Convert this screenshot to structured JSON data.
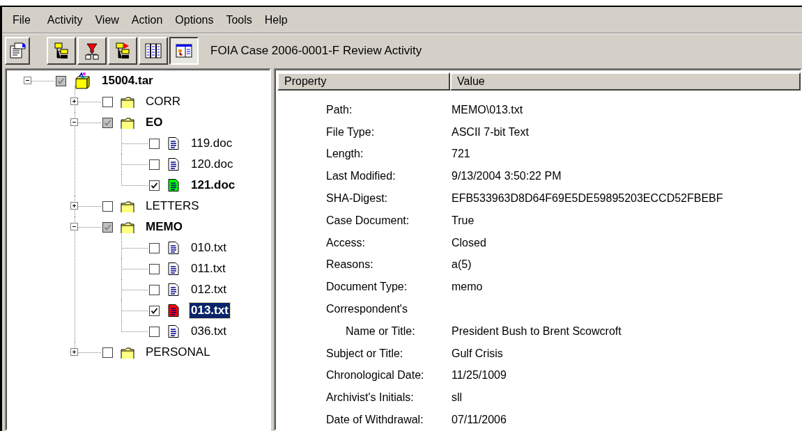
{
  "menu_bar": [
    "File",
    "Activity",
    "View",
    "Action",
    "Options",
    "Tools",
    "Help"
  ],
  "toolbar": {
    "button_groups": [
      [
        {
          "kind": "properties",
          "pressed": false
        }
      ],
      [
        {
          "kind": "tree-yellow",
          "pressed": false
        },
        {
          "kind": "tree-red",
          "pressed": false
        },
        {
          "kind": "tree-flag",
          "pressed": false
        },
        {
          "kind": "columns",
          "pressed": false
        },
        {
          "kind": "details",
          "pressed": true
        }
      ]
    ],
    "title": "FOIA Case 2006-0001-F Review Activity"
  },
  "tree": [
    {
      "name": "15004.tar",
      "kind": "archive",
      "checked": true,
      "partial": true,
      "bold": true,
      "selected": false,
      "expanded": true,
      "children": [
        {
          "name": "CORR",
          "kind": "folder",
          "checked": false,
          "partial": false,
          "bold": false,
          "selected": false,
          "expanded": false
        },
        {
          "name": "EO",
          "kind": "folder",
          "checked": true,
          "partial": true,
          "bold": true,
          "selected": false,
          "expanded": true,
          "children": [
            {
              "name": "119.doc",
              "kind": "document",
              "checked": false,
              "partial": false,
              "bold": false,
              "selected": false
            },
            {
              "name": "120.doc",
              "kind": "document",
              "checked": false,
              "partial": false,
              "bold": false,
              "selected": false
            },
            {
              "name": "121.doc",
              "kind": "document",
              "color": "#00ff00",
              "checked": true,
              "partial": false,
              "bold": true,
              "selected": false
            }
          ]
        },
        {
          "name": "LETTERS",
          "kind": "folder",
          "checked": false,
          "partial": false,
          "bold": false,
          "selected": false,
          "expanded": false
        },
        {
          "name": "MEMO",
          "kind": "folder",
          "checked": true,
          "partial": true,
          "bold": true,
          "selected": false,
          "expanded": true,
          "children": [
            {
              "name": "010.txt",
              "kind": "document",
              "checked": false,
              "partial": false,
              "bold": false,
              "selected": false
            },
            {
              "name": "011.txt",
              "kind": "document",
              "checked": false,
              "partial": false,
              "bold": false,
              "selected": false
            },
            {
              "name": "012.txt",
              "kind": "document",
              "checked": false,
              "partial": false,
              "bold": false,
              "selected": false
            },
            {
              "name": "013.txt",
              "kind": "document",
              "color": "#ff0000",
              "checked": true,
              "partial": false,
              "bold": true,
              "selected": true
            },
            {
              "name": "036.txt",
              "kind": "document",
              "checked": false,
              "partial": false,
              "bold": false,
              "selected": false
            }
          ]
        },
        {
          "name": "PERSONAL",
          "kind": "folder",
          "checked": false,
          "partial": false,
          "bold": false,
          "selected": false,
          "expanded": false
        }
      ]
    }
  ],
  "properties": {
    "columns": [
      "Property",
      "Value"
    ],
    "rows": [
      {
        "kind": "field",
        "property": "Path:",
        "value": "MEMO\\013.txt"
      },
      {
        "kind": "field",
        "property": "File Type:",
        "value": "ASCII 7-bit Text"
      },
      {
        "kind": "field",
        "property": "Length:",
        "value": "721"
      },
      {
        "kind": "field",
        "property": "Last Modified:",
        "value": "9/13/2004 3:50:22 PM"
      },
      {
        "kind": "field",
        "property": "SHA-Digest:",
        "value": "EFB533963D8D64F69E5DE59895203ECCD52FBEBF"
      },
      {
        "kind": "field",
        "property": "Case Document:",
        "value": "True"
      },
      {
        "kind": "field",
        "property": "Access:",
        "value": "Closed"
      },
      {
        "kind": "field",
        "property": "Reasons:",
        "value": "a(5)"
      },
      {
        "kind": "field",
        "property": "Document Type:",
        "value": "memo"
      },
      {
        "kind": "field",
        "property": "Correspondent's"
      },
      {
        "kind": "subfield",
        "property": "Name or Title:",
        "value": "President Bush to Brent Scowcroft"
      },
      {
        "kind": "field",
        "property": "Subject or Title:",
        "value": "Gulf Crisis"
      },
      {
        "kind": "field",
        "property": "Chronological Date:",
        "value": "11/25/1009"
      },
      {
        "kind": "field",
        "property": "Archivist's Initials:",
        "value": "sll"
      },
      {
        "kind": "field",
        "property": "Date of Withdrawal:",
        "value": "07/11/2006"
      }
    ]
  }
}
